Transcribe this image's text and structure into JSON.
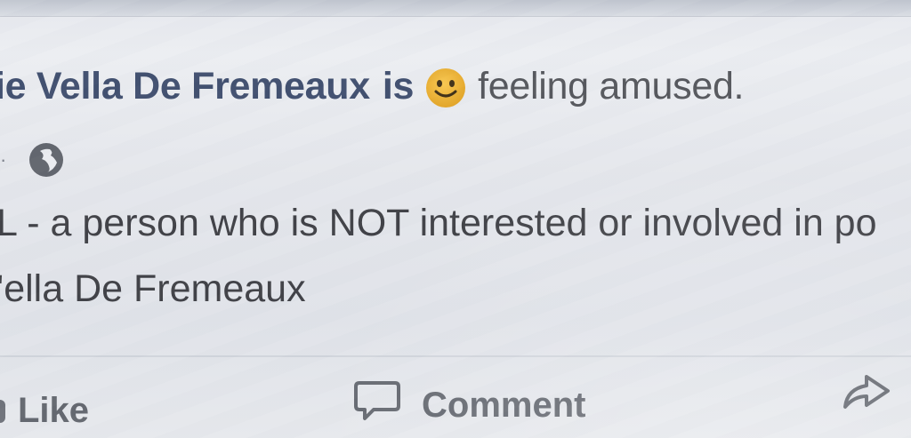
{
  "post": {
    "author_name": "ie Vella De Fremeaux",
    "verb": "is",
    "feeling_emoji": "smiling-face-icon",
    "feeling_text": "feeling amused.",
    "meta_separator": "·",
    "privacy_icon": "globe-icon",
    "body_line_1": "L - a person who is NOT interested or involved in po",
    "body_line_2": "'ella De Fremeaux"
  },
  "actions": {
    "like_label": "Like",
    "comment_label": "Comment",
    "share_icon": "share-arrow-icon"
  },
  "colors": {
    "author": "#3b4a6b",
    "body_text": "#3a3b40",
    "action_text": "#5f636b",
    "emoji": "#eab22d"
  }
}
